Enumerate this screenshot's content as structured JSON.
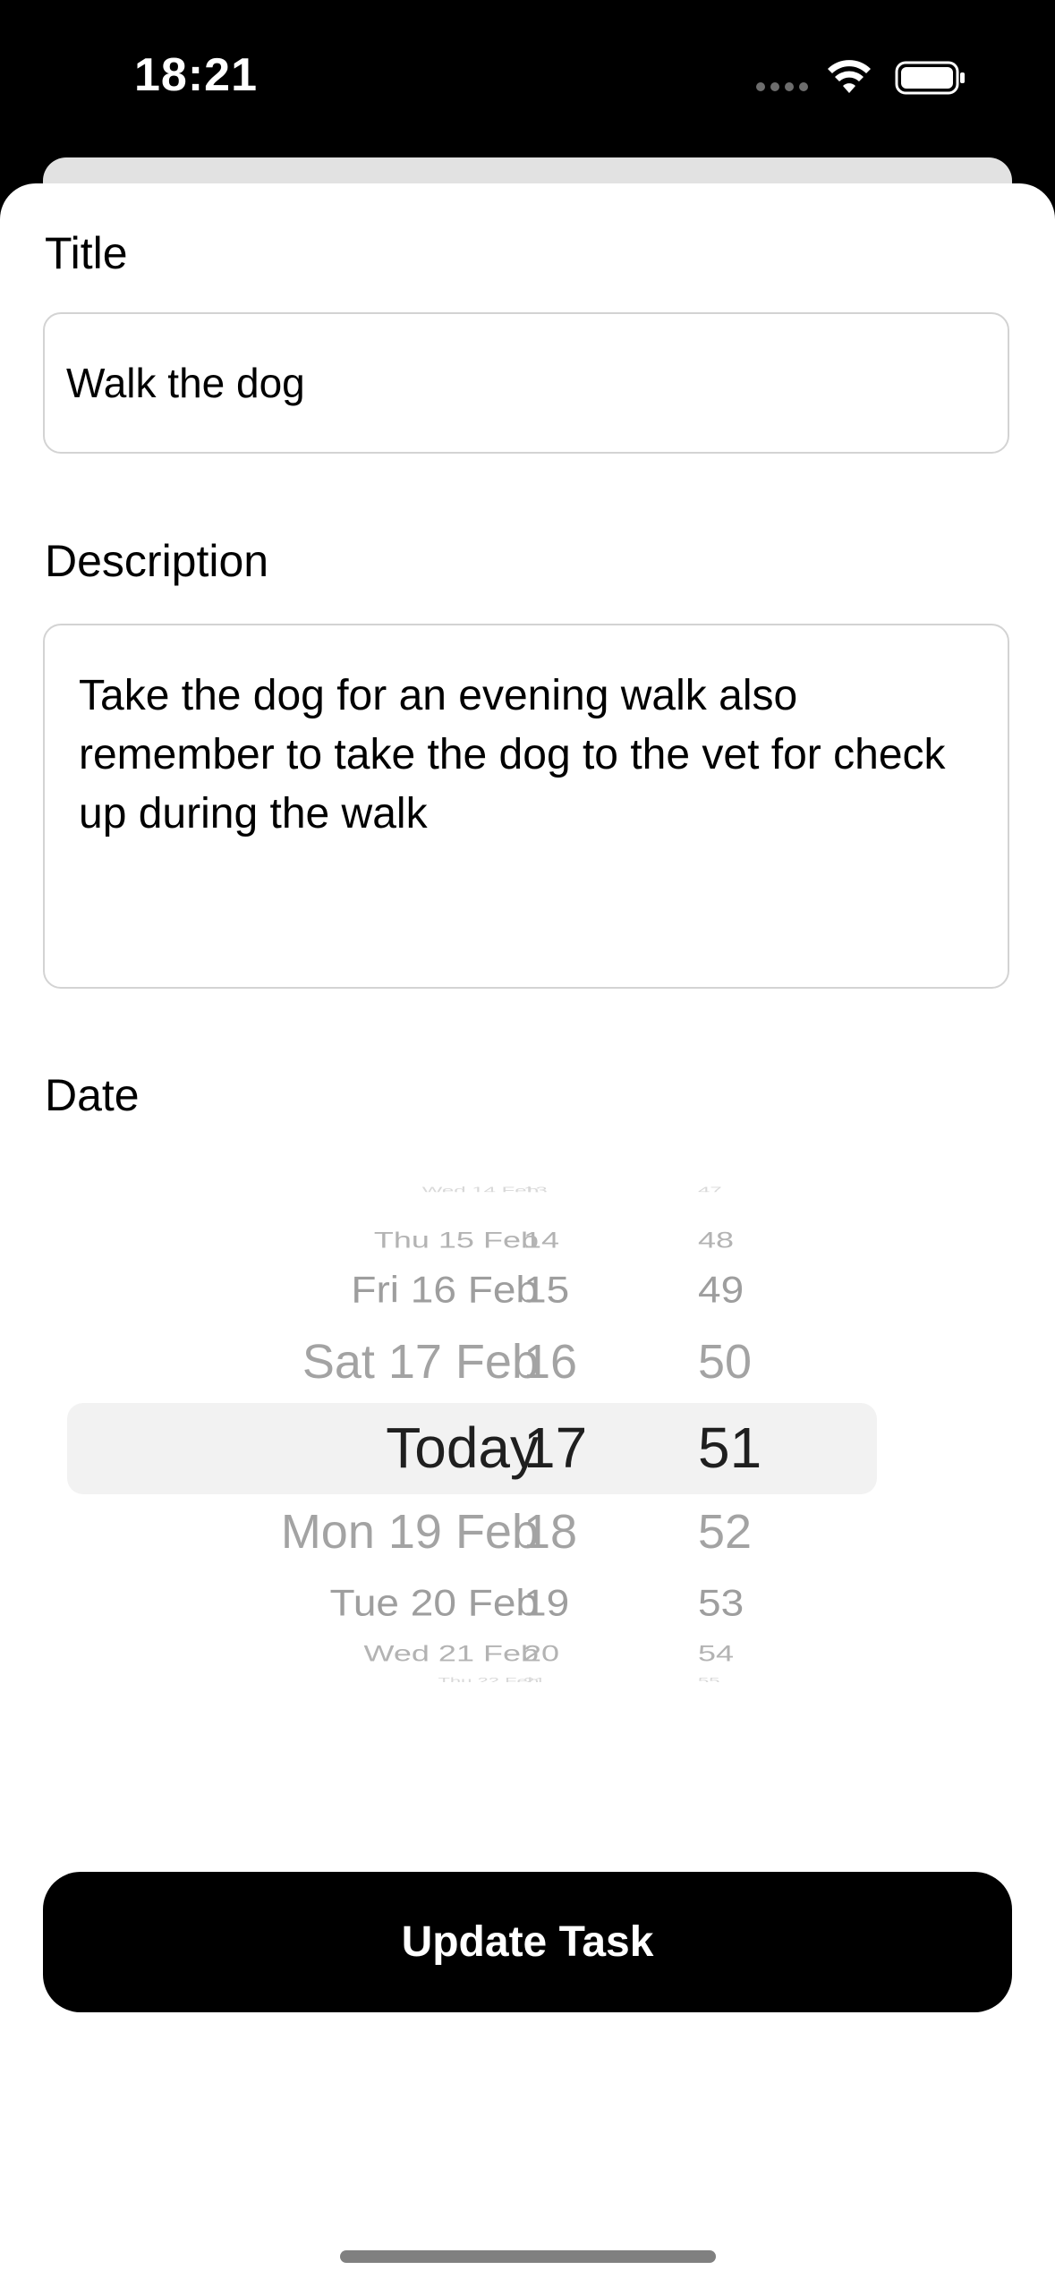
{
  "status_bar": {
    "time": "18:21",
    "icons": [
      "signal-dots-icon",
      "wifi-icon",
      "battery-icon"
    ]
  },
  "form": {
    "title_label": "Title",
    "title_value": "Walk the dog",
    "description_label": "Description",
    "description_value": "Take the dog for an evening walk also remember to take the dog to the vet for check up during the walk",
    "date_label": "Date"
  },
  "date_picker": {
    "rows": [
      {
        "date": "Wed 14 Feb",
        "hour": "13",
        "minute": "47"
      },
      {
        "date": "Thu 15 Feb",
        "hour": "14",
        "minute": "48"
      },
      {
        "date": "Fri 16 Feb",
        "hour": "15",
        "minute": "49"
      },
      {
        "date": "Sat 17 Feb",
        "hour": "16",
        "minute": "50"
      },
      {
        "date": "Today",
        "hour": "17",
        "minute": "51"
      },
      {
        "date": "Mon 19 Feb",
        "hour": "18",
        "minute": "52"
      },
      {
        "date": "Tue 20 Feb",
        "hour": "19",
        "minute": "53"
      },
      {
        "date": "Wed 21 Feb",
        "hour": "20",
        "minute": "54"
      },
      {
        "date": "Thu 22 Feb",
        "hour": "21",
        "minute": "55"
      }
    ],
    "selected_index": 4
  },
  "actions": {
    "update_label": "Update Task"
  },
  "colors": {
    "background": "#000000",
    "sheet": "#ffffff",
    "button": "#000000",
    "button_text": "#ffffff",
    "picker_selected": "#f2f2f2"
  }
}
